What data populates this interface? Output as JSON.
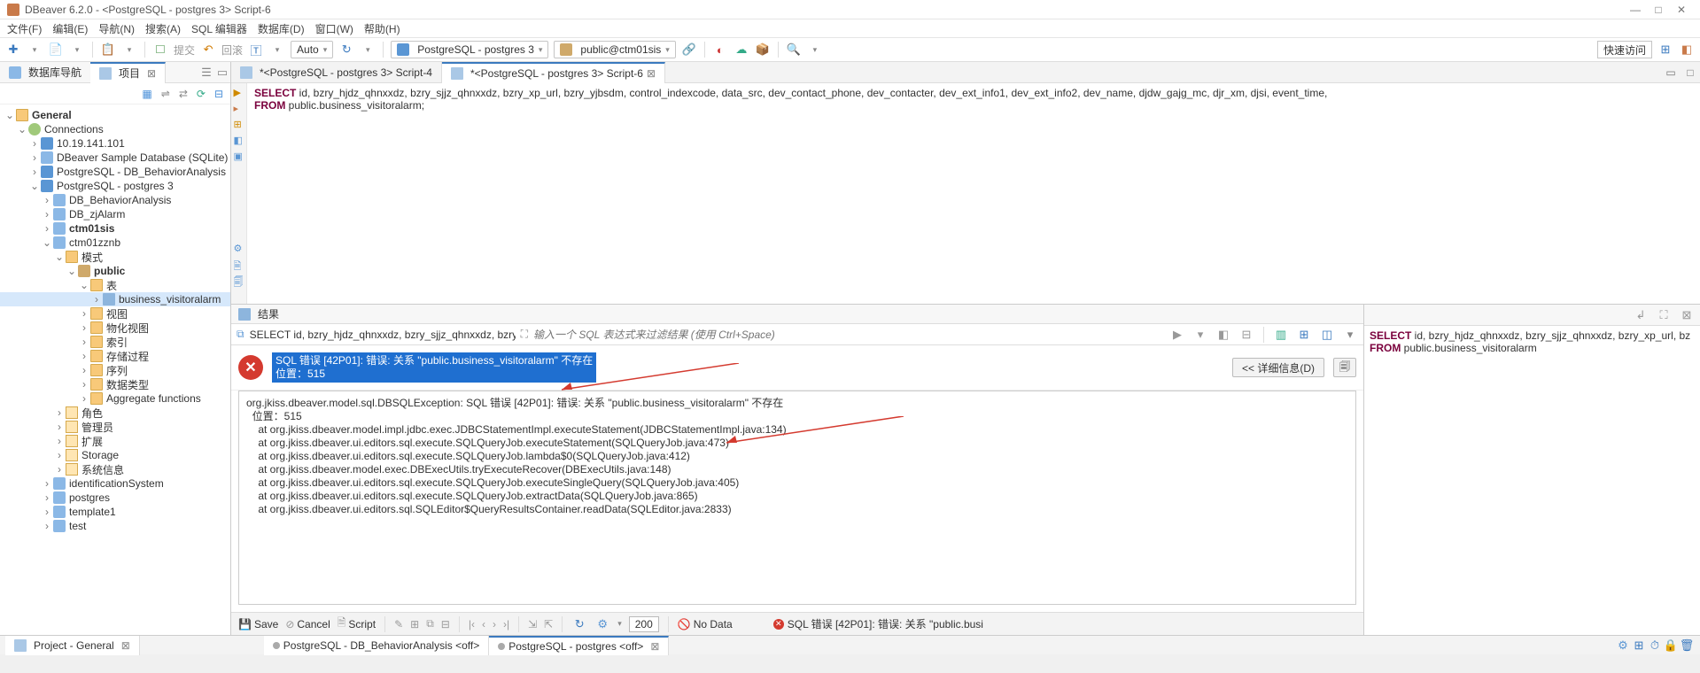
{
  "app": {
    "title": "DBeaver 6.2.0 - <PostgreSQL - postgres 3> Script-6"
  },
  "menu": [
    "文件(F)",
    "编辑(E)",
    "导航(N)",
    "搜索(A)",
    "SQL 编辑器",
    "数据库(D)",
    "窗口(W)",
    "帮助(H)"
  ],
  "toolbar": {
    "auto": "Auto",
    "conn": "PostgreSQL - postgres 3",
    "schema": "public@ctm01sis",
    "quick": "快速访问"
  },
  "left_tabs": {
    "t1": "数据库导航",
    "t2": "项目"
  },
  "tree": {
    "general": "General",
    "connections": "Connections",
    "n1": "10.19.141.101",
    "n2": "DBeaver Sample Database (SQLite)",
    "n3": "PostgreSQL - DB_BehaviorAnalysis",
    "n4": "PostgreSQL - postgres 3",
    "db1": "DB_BehaviorAnalysis",
    "db2": "DB_zjAlarm",
    "db3": "ctm01sis",
    "db4": "ctm01zznb",
    "sch": "模式",
    "pub": "public",
    "tbl_h": "表",
    "tbl": "business_visitoralarm",
    "v": "视图",
    "mv": "物化视图",
    "idx": "索引",
    "sp": "存储过程",
    "seq": "序列",
    "dt": "数据类型",
    "af": "Aggregate functions",
    "role": "角色",
    "admin": "管理员",
    "ext": "扩展",
    "stg": "Storage",
    "sys": "系统信息",
    "db5": "identificationSystem",
    "db6": "postgres",
    "db7": "template1",
    "db8": "test"
  },
  "editor_tabs": {
    "t1": "*<PostgreSQL - postgres 3> Script-4",
    "t2": "*<PostgreSQL - postgres 3> Script-6"
  },
  "sql": {
    "select": "SELECT",
    "cols": " id, bzry_hjdz_qhnxxdz, bzry_sjjz_qhnxxdz, bzry_xp_url, bzry_yjbsdm, control_indexcode, data_src, dev_contact_phone, dev_contacter, dev_ext_info1, dev_ext_info2, dev_name, djdw_gajg_mc, djr_xm, djsi, event_time, ",
    "from": "FROM",
    "tbl": " public.business_visitoralarm;"
  },
  "result": {
    "tab": "结果",
    "query": "SELECT id, bzry_hjdz_qhnxxdz, bzry_sjjz_qhnxxdz, bzry_xp_url, bz",
    "filter_ph": "输入一个 SQL 表达式来过滤结果 (使用 Ctrl+Space)",
    "err1": "SQL 错误 [42P01]: 错误: 关系 \"public.business_visitoralarm\" 不存在",
    "err2": "位置：515",
    "detail_btn": "<< 详细信息(D)",
    "stack": [
      "org.jkiss.dbeaver.model.sql.DBSQLException: SQL 错误 [42P01]: 错误: 关系 \"public.business_visitoralarm\" 不存在",
      "  位置：515",
      "    at org.jkiss.dbeaver.model.impl.jdbc.exec.JDBCStatementImpl.executeStatement(JDBCStatementImpl.java:134)",
      "    at org.jkiss.dbeaver.ui.editors.sql.execute.SQLQueryJob.executeStatement(SQLQueryJob.java:473)",
      "    at org.jkiss.dbeaver.ui.editors.sql.execute.SQLQueryJob.lambda$0(SQLQueryJob.java:412)",
      "    at org.jkiss.dbeaver.model.exec.DBExecUtils.tryExecuteRecover(DBExecUtils.java:148)",
      "    at org.jkiss.dbeaver.ui.editors.sql.execute.SQLQueryJob.executeSingleQuery(SQLQueryJob.java:405)",
      "    at org.jkiss.dbeaver.ui.editors.sql.execute.SQLQueryJob.extractData(SQLQueryJob.java:865)",
      "    at org.jkiss.dbeaver.ui.editors.sql.SQLEditor$QueryResultsContainer.readData(SQLEditor.java:2833)"
    ]
  },
  "bbar": {
    "save": "Save",
    "cancel": "Cancel",
    "script": "Script",
    "rows": "200",
    "nodata": "No Data",
    "err": "SQL 错误 [42P01]: 错误: 关系 \"public.busi"
  },
  "right_sql": {
    "select": "SELECT",
    "cols": " id, bzry_hjdz_qhnxxdz, bzry_sjjz_qhnxxdz, bzry_xp_url, bz",
    "from": "FROM",
    "tbl": " public.business_visitoralarm"
  },
  "status": {
    "s1": "Project - General",
    "s2": "PostgreSQL - DB_BehaviorAnalysis <off>",
    "s3": "PostgreSQL - postgres <off>"
  }
}
